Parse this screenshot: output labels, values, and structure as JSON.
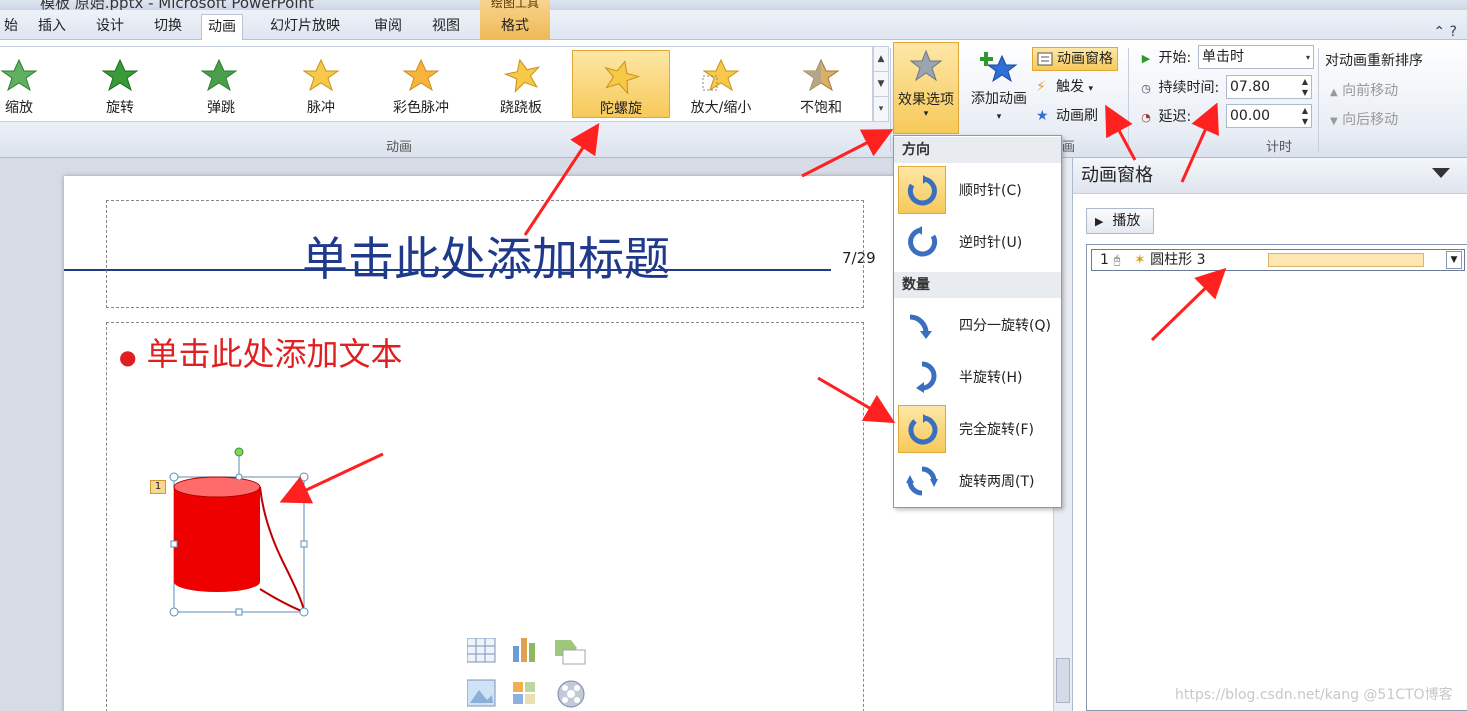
{
  "window": {
    "title": "模板 原始.pptx - Microsoft PowerPoint"
  },
  "tabs": [
    "始",
    "插入",
    "设计",
    "切换",
    "动画",
    "幻灯片放映",
    "审阅",
    "视图"
  ],
  "contextual_tab": {
    "caption": "绘图工具",
    "label": "格式"
  },
  "gallery": {
    "items": [
      "缩放",
      "旋转",
      "弹跳",
      "脉冲",
      "彩色脉冲",
      "跷跷板",
      "陀螺旋",
      "放大/缩小",
      "不饱和"
    ],
    "selected": "陀螺旋",
    "group_label": "动画"
  },
  "effect_options": {
    "label": "效果选项"
  },
  "add_animation": {
    "label": "添加动画"
  },
  "advanced": {
    "pane_btn": "动画窗格",
    "trigger": "触发",
    "painter": "动画刷",
    "group_label": "画"
  },
  "timing": {
    "start_label": "开始:",
    "start_value": "单击时",
    "duration_label": "持续时间:",
    "duration_value": "07.80",
    "delay_label": "延迟:",
    "delay_value": "00.00",
    "group_label": "计时",
    "reorder_title": "对动画重新排序",
    "move_earlier": "向前移动",
    "move_later": "向后移动"
  },
  "menu": {
    "direction_head": "方向",
    "clockwise": "顺时针(C)",
    "counterclockwise": "逆时针(U)",
    "amount_head": "数量",
    "quarter": "四分一旋转(Q)",
    "half": "半旋转(H)",
    "full": "完全旋转(F)",
    "two": "旋转两周(T)"
  },
  "slide": {
    "title": "单击此处添加标题",
    "page": "7/29",
    "body": "单击此处添加文本",
    "anim_tag": "1"
  },
  "anim_pane": {
    "title": "动画窗格",
    "play": "播放",
    "item_index": "1",
    "item_name": "圆柱形 3"
  },
  "watermark": "https://blog.csdn.net/kang @51CTO博客",
  "colors": {
    "accent": "#f7c95a",
    "title_blue": "#1f3a8a",
    "body_red": "#e02020",
    "arrow_red": "#ff2020"
  }
}
